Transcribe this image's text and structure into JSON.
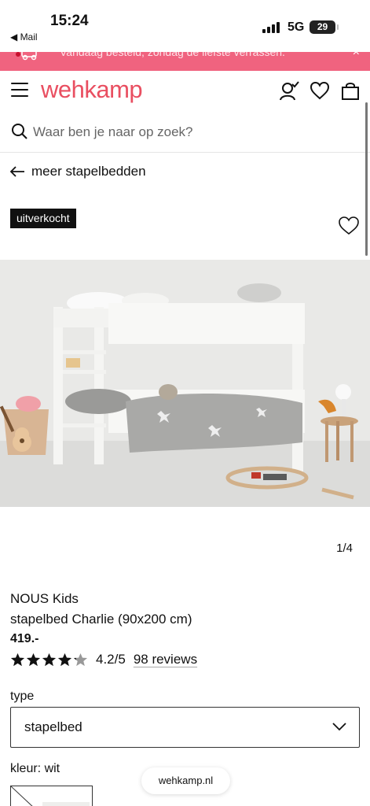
{
  "status_bar": {
    "time": "15:24",
    "back_label": "◀ Mail",
    "network": "5G",
    "battery": "29"
  },
  "promo": {
    "text": "Vandaag besteld, zondag de liefste verrassen.",
    "close": "×"
  },
  "header": {
    "logo": "wehkamp",
    "accent_color": "#e94f61"
  },
  "search": {
    "placeholder": "Waar ben je naar op zoek?"
  },
  "nav": {
    "back_label": "meer stapelbedden"
  },
  "product": {
    "badge": "uitverkocht",
    "image_counter": "1/4",
    "brand": "NOUS Kids",
    "name": "stapelbed Charlie (90x200 cm)",
    "price": "419.-",
    "rating": 4.2,
    "rating_label": "4.2/5",
    "reviews_label": "98 reviews"
  },
  "options": {
    "type_label": "type",
    "type_value": "stapelbed",
    "color_label": "kleur: wit"
  },
  "browser": {
    "url": "wehkamp.nl"
  }
}
